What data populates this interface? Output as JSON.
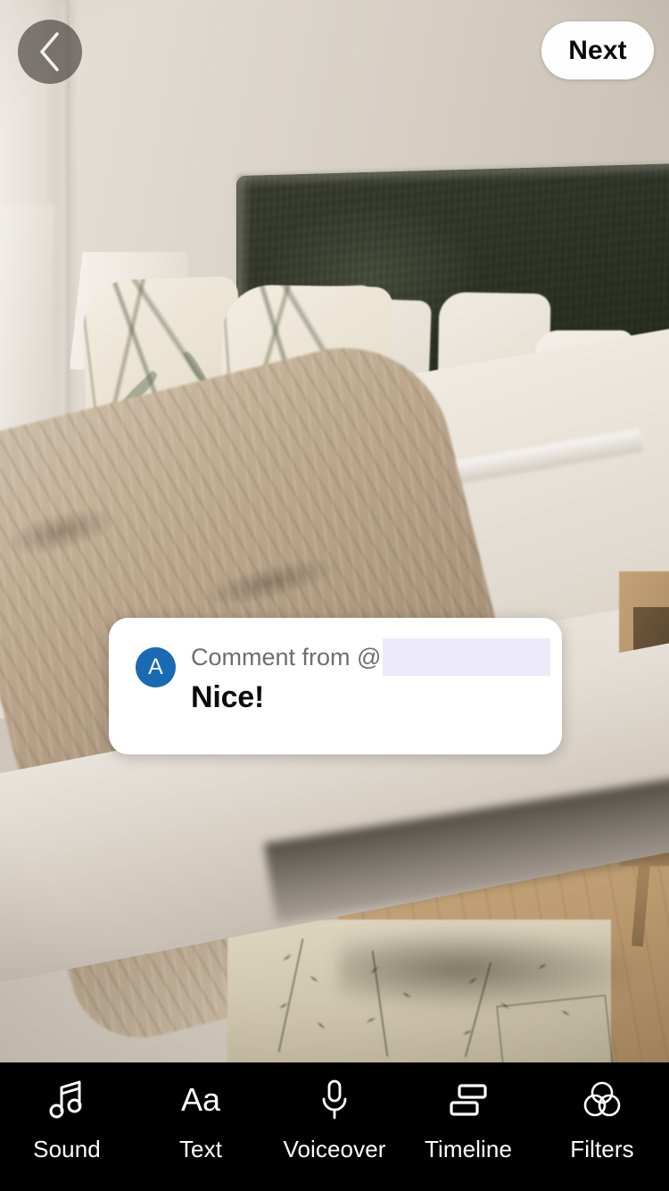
{
  "app": {
    "screen_name": "video-editor-comment-reply",
    "background_description": "Bedroom photo with dark green velvet headboard, botanical-print pillows, cream bedding, fur throw, wooden nightstand and leaf-pattern rug"
  },
  "topbar": {
    "back_icon": "chevron-left-icon",
    "next_label": "Next"
  },
  "comment_sticker": {
    "avatar_initial": "A",
    "avatar_color": "#1a69b3",
    "from_label": "Comment from @",
    "username_redacted": true,
    "username_redaction_color": "#eceaf8",
    "body": "Nice!",
    "card_color": "#ffffff"
  },
  "toolbar": {
    "background": "#000000",
    "items": [
      {
        "label": "Sound",
        "icon": "music-note-icon"
      },
      {
        "label": "Text",
        "icon": "text-aa-icon"
      },
      {
        "label": "Voiceover",
        "icon": "microphone-icon"
      },
      {
        "label": "Timeline",
        "icon": "timeline-clips-icon"
      },
      {
        "label": "Filters",
        "icon": "filters-venn-icon"
      }
    ]
  }
}
